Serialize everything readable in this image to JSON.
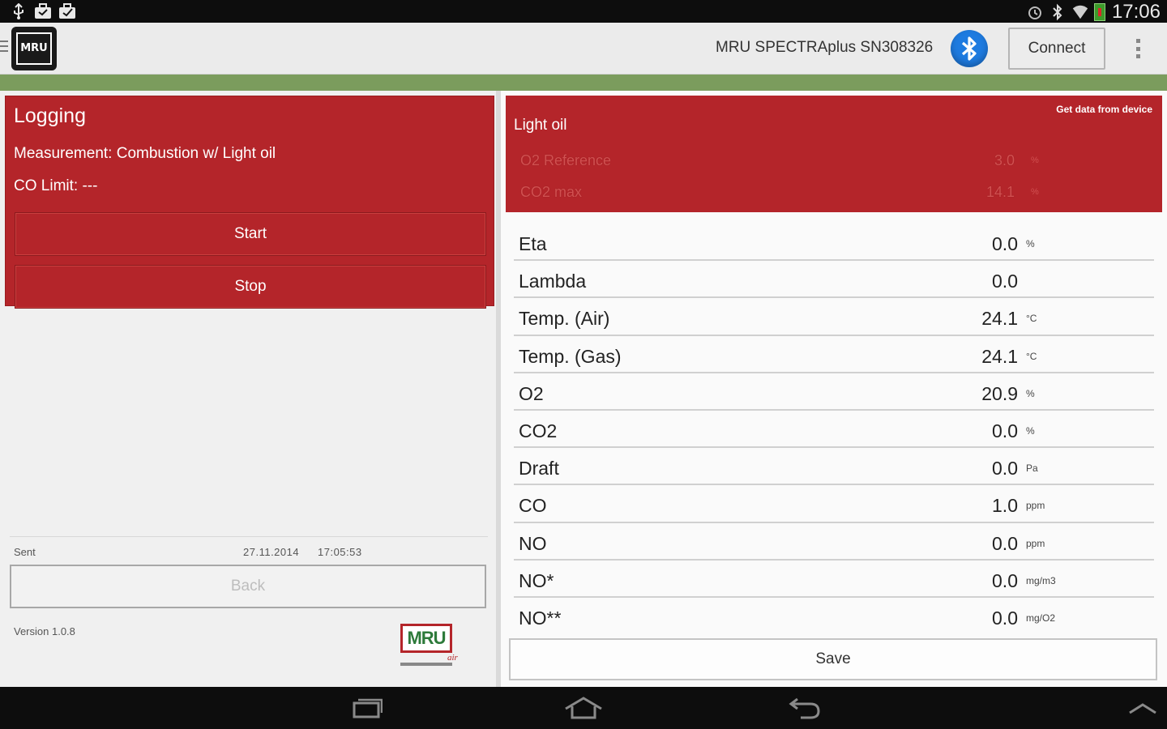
{
  "statusbar": {
    "left_icons": [
      "usb-icon",
      "briefcase-icon",
      "briefcase-check-icon"
    ],
    "right_icons": [
      "alarm-icon",
      "bluetooth-status-icon",
      "wifi-icon",
      "battery-charging-icon"
    ],
    "time": "17:06"
  },
  "actionbar": {
    "device_name": "MRU SPECTRAplus SN308326",
    "connect_label": "Connect"
  },
  "logging": {
    "title": "Logging",
    "measurement": "Measurement: Combustion w/ Light oil",
    "co_limit": "CO Limit: ---",
    "start_label": "Start",
    "stop_label": "Stop"
  },
  "sent": {
    "label": "Sent",
    "date": "27.11.2014",
    "time": "17:05:53"
  },
  "back_label": "Back",
  "version": "Version 1.0.8",
  "brand": {
    "logo_text": "MRU",
    "logo_suffix": "air",
    "colors": {
      "primary_red": "#b4252a",
      "accent_green": "#7b9c5d",
      "bluetooth_blue": "#1e7be0"
    }
  },
  "fuel": {
    "get_data_label": "Get data from device",
    "name": "Light oil",
    "rows": [
      {
        "label": "O2 Reference",
        "value": "3.0",
        "unit": "%"
      },
      {
        "label": "CO2 max",
        "value": "14.1",
        "unit": "%"
      }
    ]
  },
  "measurements": [
    {
      "label": "Eta",
      "value": "0.0",
      "unit": "%"
    },
    {
      "label": "Lambda",
      "value": "0.0",
      "unit": ""
    },
    {
      "label": "Temp. (Air)",
      "value": "24.1",
      "unit": "°C"
    },
    {
      "label": "Temp. (Gas)",
      "value": "24.1",
      "unit": "°C"
    },
    {
      "label": "O2",
      "value": "20.9",
      "unit": "%"
    },
    {
      "label": "CO2",
      "value": "0.0",
      "unit": "%"
    },
    {
      "label": "Draft",
      "value": "0.0",
      "unit": "Pa"
    },
    {
      "label": "CO",
      "value": "1.0",
      "unit": "ppm"
    },
    {
      "label": "NO",
      "value": "0.0",
      "unit": "ppm"
    },
    {
      "label": "NO*",
      "value": "0.0",
      "unit": "mg/m3"
    },
    {
      "label": "NO**",
      "value": "0.0",
      "unit": "mg/O2"
    }
  ],
  "save_label": "Save",
  "navbar": {
    "buttons": [
      "recent-apps-icon",
      "home-icon",
      "back-icon",
      "chevron-up-icon"
    ]
  }
}
